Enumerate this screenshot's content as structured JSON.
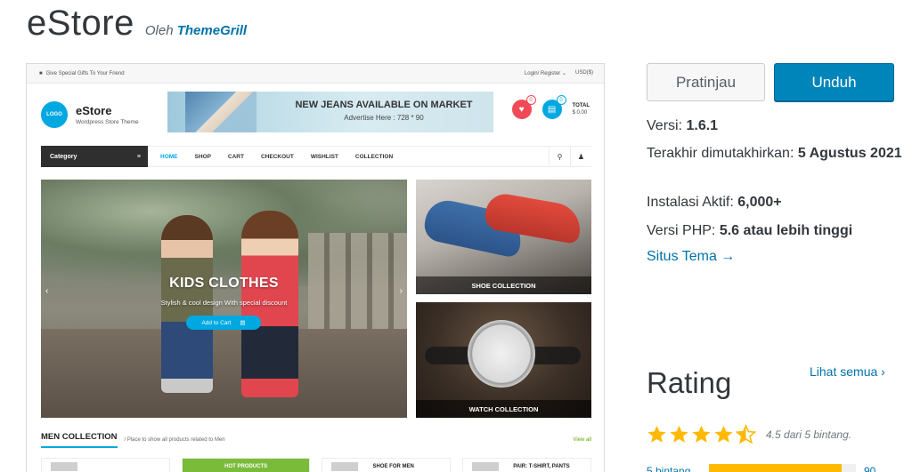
{
  "theme": {
    "name": "eStore",
    "by_label": "Oleh",
    "author": "ThemeGrill"
  },
  "screenshot": {
    "topbar_left": "Give Special Gifts To Your Friend",
    "topbar_login": "Login/ Register ⌄",
    "topbar_currency": "USD($)",
    "logo_text": "LOGO",
    "site_title": "eStore",
    "site_tagline": "Wordpress Store Theme",
    "banner_title": "NEW JEANS AVAILABLE ON MARKET",
    "banner_sub": "Advertise Here : 728 * 90",
    "wishlist_count": "0",
    "cart_count": "0",
    "total_label": "TOTAL",
    "total_value": "$ 0.00",
    "category_label": "Category",
    "nav": [
      "HOME",
      "SHOP",
      "CART",
      "CHECKOUT",
      "WISHLIST",
      "COLLECTION"
    ],
    "hero_title": "KIDS CLOTHES",
    "hero_sub": "Stylish & cool design With special discount",
    "hero_button": "Add to Cart",
    "promo_shoe": "SHOE COLLECTION",
    "promo_watch": "WATCH COLLECTION",
    "men_title": "MEN COLLECTION",
    "men_desc": "/ Place to show all products related to Men",
    "men_view_all": "View all",
    "card_hot": "HOT PRODUCTS",
    "card_shoe": "SHOE FOR MEN",
    "card_pair": "PAIR: T-SHIRT, PANTS"
  },
  "actions": {
    "preview_label": "Pratinjau",
    "download_label": "Unduh"
  },
  "meta": {
    "version_label": "Versi: ",
    "version_value": "1.6.1",
    "updated_label": "Terakhir dimutakhirkan: ",
    "updated_value": "5 Agustus 2021",
    "installs_label": "Instalasi Aktif: ",
    "installs_value": "6,000+",
    "php_label": "Versi PHP: ",
    "php_value": "5.6 atau lebih tinggi",
    "theme_link": "Situs Tema →"
  },
  "rating": {
    "title": "Rating",
    "see_all": "Lihat semua ›",
    "score": 4.5,
    "score_text": "4.5 dari 5 bintang.",
    "star_color": "#ffb900",
    "bar_label": "5 bintang",
    "bar_fraction": 0.9,
    "bar_count": "90"
  },
  "colors": {
    "accent": "#0073aa",
    "download_bg": "#0085ba",
    "estore_blue": "#00a8e1"
  }
}
